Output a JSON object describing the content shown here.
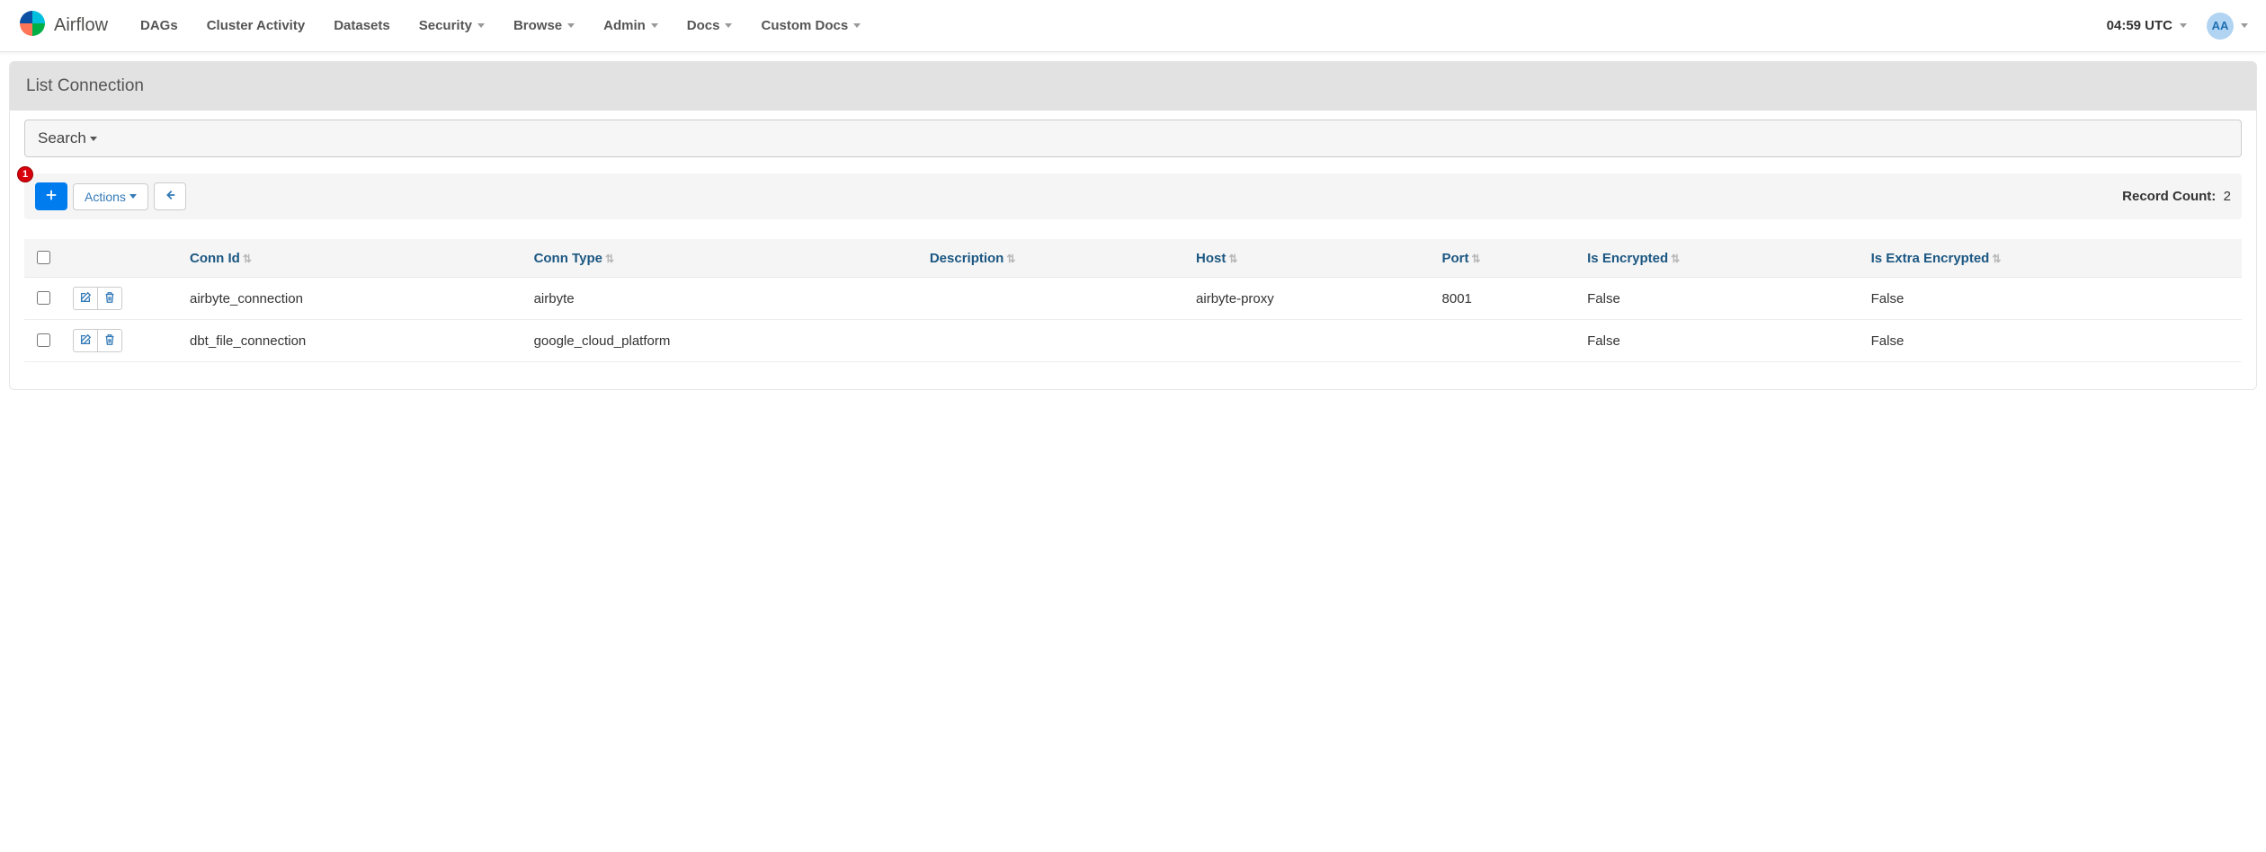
{
  "brand": "Airflow",
  "nav": {
    "items": [
      {
        "label": "DAGs",
        "dropdown": false
      },
      {
        "label": "Cluster Activity",
        "dropdown": false
      },
      {
        "label": "Datasets",
        "dropdown": false
      },
      {
        "label": "Security",
        "dropdown": true
      },
      {
        "label": "Browse",
        "dropdown": true
      },
      {
        "label": "Admin",
        "dropdown": true
      },
      {
        "label": "Docs",
        "dropdown": true
      },
      {
        "label": "Custom Docs",
        "dropdown": true
      }
    ],
    "time": "04:59 UTC",
    "avatar": "AA"
  },
  "page": {
    "title": "List Connection",
    "search_label": "Search",
    "badge": "1",
    "actions_label": "Actions",
    "record_count_label": "Record Count:",
    "record_count": "2"
  },
  "table": {
    "columns": [
      {
        "label": "Conn Id",
        "sortable": true
      },
      {
        "label": "Conn Type",
        "sortable": true
      },
      {
        "label": "Description",
        "sortable": true
      },
      {
        "label": "Host",
        "sortable": true
      },
      {
        "label": "Port",
        "sortable": true
      },
      {
        "label": "Is Encrypted",
        "sortable": true
      },
      {
        "label": "Is Extra Encrypted",
        "sortable": true
      }
    ],
    "rows": [
      {
        "conn_id": "airbyte_connection",
        "conn_type": "airbyte",
        "description": "",
        "host": "airbyte-proxy",
        "port": "8001",
        "is_encrypted": "False",
        "is_extra_encrypted": "False"
      },
      {
        "conn_id": "dbt_file_connection",
        "conn_type": "google_cloud_platform",
        "description": "",
        "host": "",
        "port": "",
        "is_encrypted": "False",
        "is_extra_encrypted": "False"
      }
    ]
  }
}
